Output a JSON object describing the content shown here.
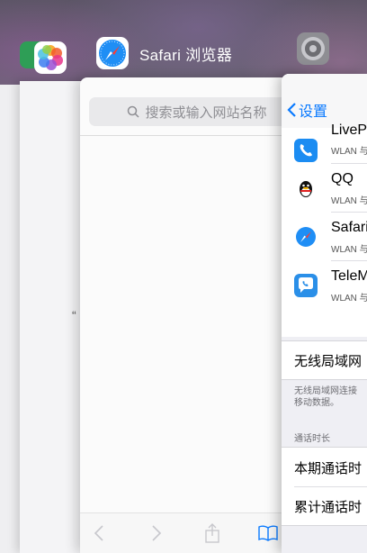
{
  "switcher": {
    "safari_title": "Safari 浏览器"
  },
  "safari": {
    "search_placeholder": "搜索或输入网站名称"
  },
  "photos_card": {
    "quote_mark": "“"
  },
  "settings": {
    "back_label": "设置",
    "apps": [
      {
        "name": "LiveP",
        "sub": "WLAN 与",
        "icon": "phone-icon",
        "color": "#1b8cf2"
      },
      {
        "name": "QQ",
        "sub": "WLAN 与",
        "icon": "qq-penguin-icon",
        "color": "#ffffff"
      },
      {
        "name": "Safari",
        "sub": "WLAN 与",
        "icon": "safari-compass-icon",
        "color": "#1f8ef5"
      },
      {
        "name": "TeleM",
        "sub": "WLAN 与",
        "icon": "chat-phone-icon",
        "color": "#2a8fe8"
      }
    ],
    "wifi_label": "无线局域网",
    "wifi_note_line1": "无线局域网连接",
    "wifi_note_line2": "移动数据。",
    "call_section_header": "通话时长",
    "current_period_label": "本期通话时",
    "total_label": "累计通话时"
  },
  "colors": {
    "accent": "#0a7aff",
    "background": "#6f6a78"
  }
}
